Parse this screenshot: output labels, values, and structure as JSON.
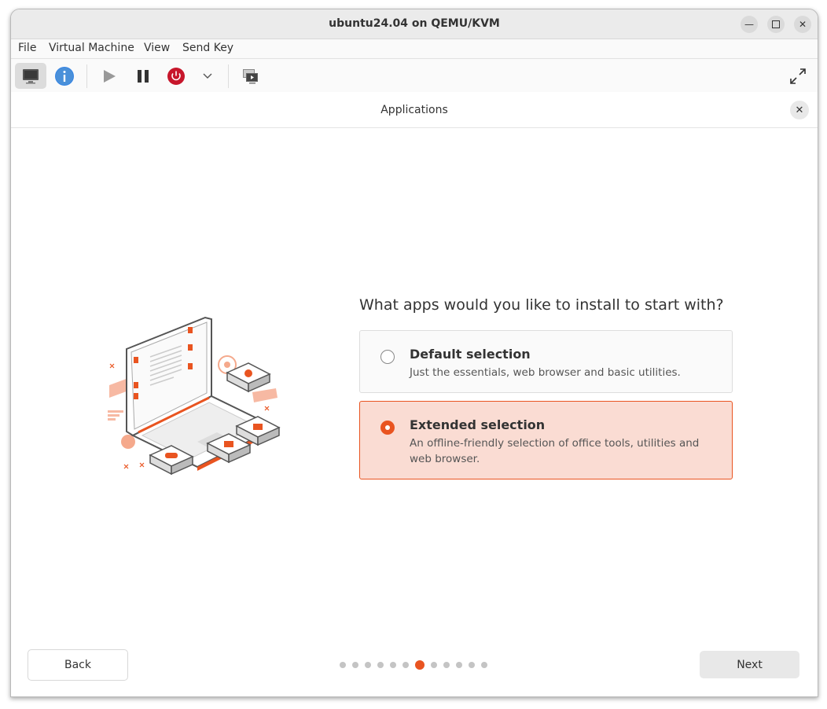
{
  "window": {
    "title": "ubuntu24.04 on QEMU/KVM"
  },
  "menubar": {
    "items": [
      "File",
      "Virtual Machine",
      "View",
      "Send Key"
    ]
  },
  "toolbar": {
    "buttons": [
      "console-icon",
      "details-icon",
      "run-icon",
      "pause-icon",
      "shutdown-icon",
      "shutdown-menu-chevron-icon",
      "snapshots-icon",
      "fullscreen-icon"
    ]
  },
  "header": {
    "title": "Applications"
  },
  "page": {
    "question": "What apps would you like to install to start with?",
    "options": [
      {
        "title": "Default selection",
        "description": "Just the essentials, web browser and basic utilities.",
        "selected": false
      },
      {
        "title": "Extended selection",
        "description": "An offline-friendly selection of office tools, utilities and web browser.",
        "selected": true
      }
    ]
  },
  "nav": {
    "back_label": "Back",
    "next_label": "Next",
    "step_count": 12,
    "current_step": 7
  },
  "colors": {
    "accent": "#e95420",
    "selected_bg": "#fadcd3"
  }
}
